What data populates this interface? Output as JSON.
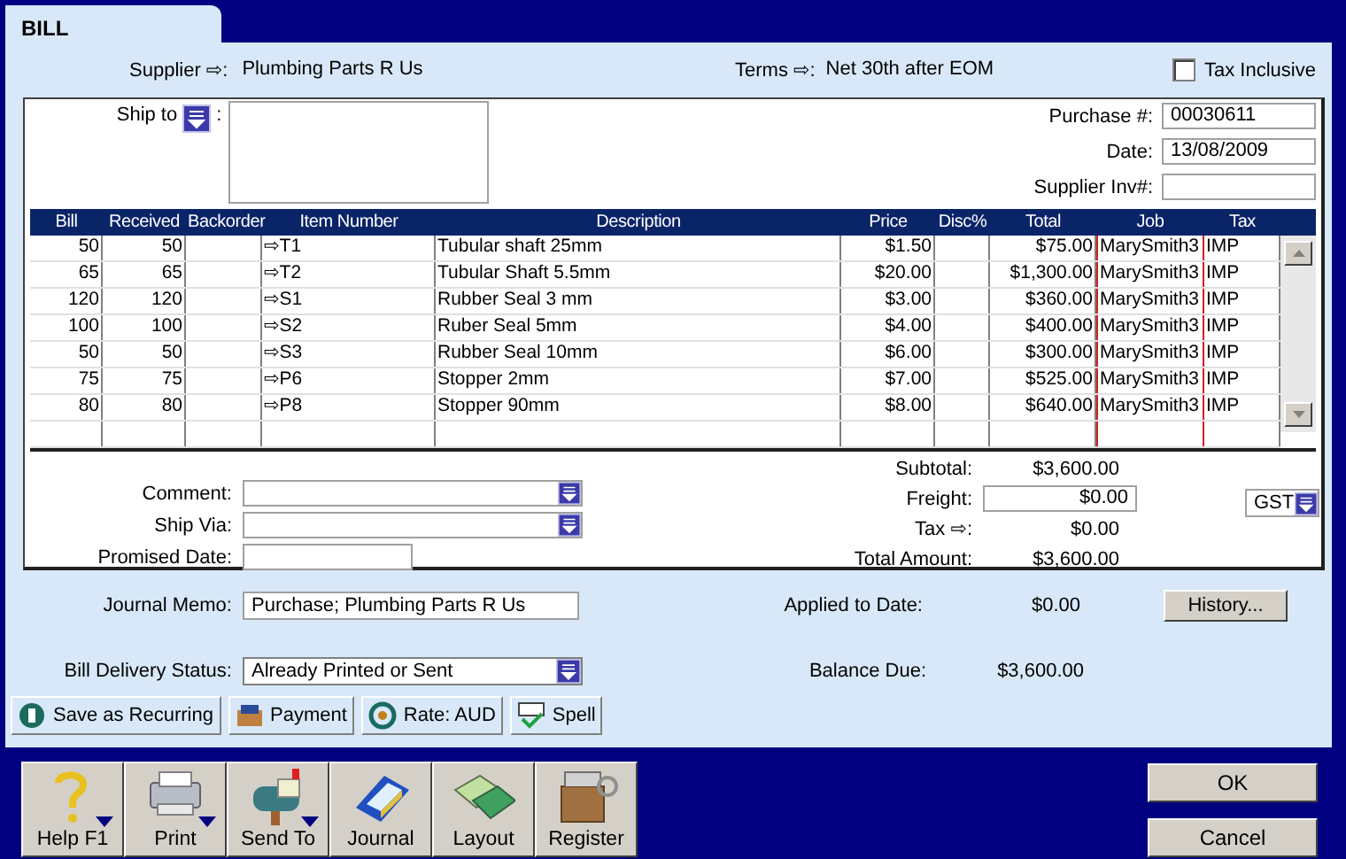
{
  "tab": {
    "label": "BILL",
    "selected": true
  },
  "header": {
    "supplier_label": "Supplier ⇨:",
    "supplier": "Plumbing Parts R Us",
    "terms_label": "Terms ⇨:",
    "terms": "Net 30th after EOM",
    "tax_inclusive": {
      "label": "Tax Inclusive",
      "checked": false
    }
  },
  "ship_to": {
    "label": "Ship to",
    "colon": ":"
  },
  "purchase_fields": [
    {
      "label": "Purchase #:",
      "value": "00030611"
    },
    {
      "label": "Date:",
      "value": "13/08/2009"
    },
    {
      "label": "Supplier Inv#:"
    }
  ],
  "table": {
    "columns": [
      "Bill",
      "Received",
      "Backorder",
      "Item Number",
      "Description",
      "Price",
      "Disc%",
      "Total",
      "Job",
      "Tax"
    ],
    "rows": [
      [
        "50",
        "50",
        "",
        "⇨T1",
        "Tubular shaft 25mm",
        "$1.50",
        "",
        "$75.00",
        "MarySmith3",
        "IMP"
      ],
      [
        "65",
        "65",
        "",
        "⇨T2",
        "Tubular Shaft 5.5mm",
        "$20.00",
        "",
        "$1,300.00",
        "MarySmith3",
        "IMP"
      ],
      [
        "120",
        "120",
        "",
        "⇨S1",
        "Rubber Seal 3 mm",
        "$3.00",
        "",
        "$360.00",
        "MarySmith3",
        "IMP"
      ],
      [
        "100",
        "100",
        "",
        "⇨S2",
        "Ruber Seal 5mm",
        "$4.00",
        "",
        "$400.00",
        "MarySmith3",
        "IMP"
      ],
      [
        "50",
        "50",
        "",
        "⇨S3",
        "Rubber Seal 10mm",
        "$6.00",
        "",
        "$300.00",
        "MarySmith3",
        "IMP"
      ],
      [
        "75",
        "75",
        "",
        "⇨P6",
        "Stopper 2mm",
        "$7.00",
        "",
        "$525.00",
        "MarySmith3",
        "IMP"
      ],
      [
        "80",
        "80",
        "",
        "⇨P8",
        "Stopper 90mm",
        "$8.00",
        "",
        "$640.00",
        "MarySmith3",
        "IMP"
      ]
    ]
  },
  "left_fields": [
    {
      "label": "Comment:",
      "kind": "dropdown"
    },
    {
      "label": "Ship Via:",
      "kind": "dropdown"
    },
    {
      "label": "Promised Date:",
      "kind": "input"
    }
  ],
  "totals": [
    {
      "label": "Subtotal:",
      "value": "$3,600.00",
      "kind": "text"
    },
    {
      "label": "Freight:",
      "value": "$0.00",
      "kind": "input"
    },
    {
      "label": "Tax ⇨:",
      "value": "$0.00",
      "kind": "text"
    },
    {
      "label": "Total Amount:",
      "value": "$3,600.00",
      "kind": "text"
    }
  ],
  "tax_code": "GST",
  "journal_memo": {
    "label": "Journal Memo:",
    "value": "Purchase; Plumbing Parts R Us"
  },
  "delivery_status": {
    "label": "Bill Delivery Status:",
    "value": "Already Printed or Sent"
  },
  "applied": {
    "label": "Applied to Date:",
    "value": "$0.00"
  },
  "balance": {
    "label": "Balance Due:",
    "value": "$3,600.00"
  },
  "history_button": "History...",
  "action_buttons": [
    {
      "label": "Save as Recurring",
      "kind": "recurring"
    },
    {
      "label": "Payment",
      "kind": "payment"
    },
    {
      "label": "Rate:  AUD",
      "kind": "rate"
    },
    {
      "label": "Spell",
      "kind": "spell"
    }
  ],
  "toolbar": [
    {
      "label": "Help F1",
      "kind": "help",
      "has_menu": true
    },
    {
      "label": "Print",
      "kind": "print",
      "has_menu": true
    },
    {
      "label": "Send To",
      "kind": "send",
      "has_menu": true
    },
    {
      "label": "Journal",
      "kind": "journal",
      "has_menu": false
    },
    {
      "label": "Layout",
      "kind": "layout",
      "has_menu": false
    },
    {
      "label": "Register",
      "kind": "register",
      "has_menu": false
    }
  ],
  "dialog_buttons": [
    "OK",
    "Cancel"
  ]
}
